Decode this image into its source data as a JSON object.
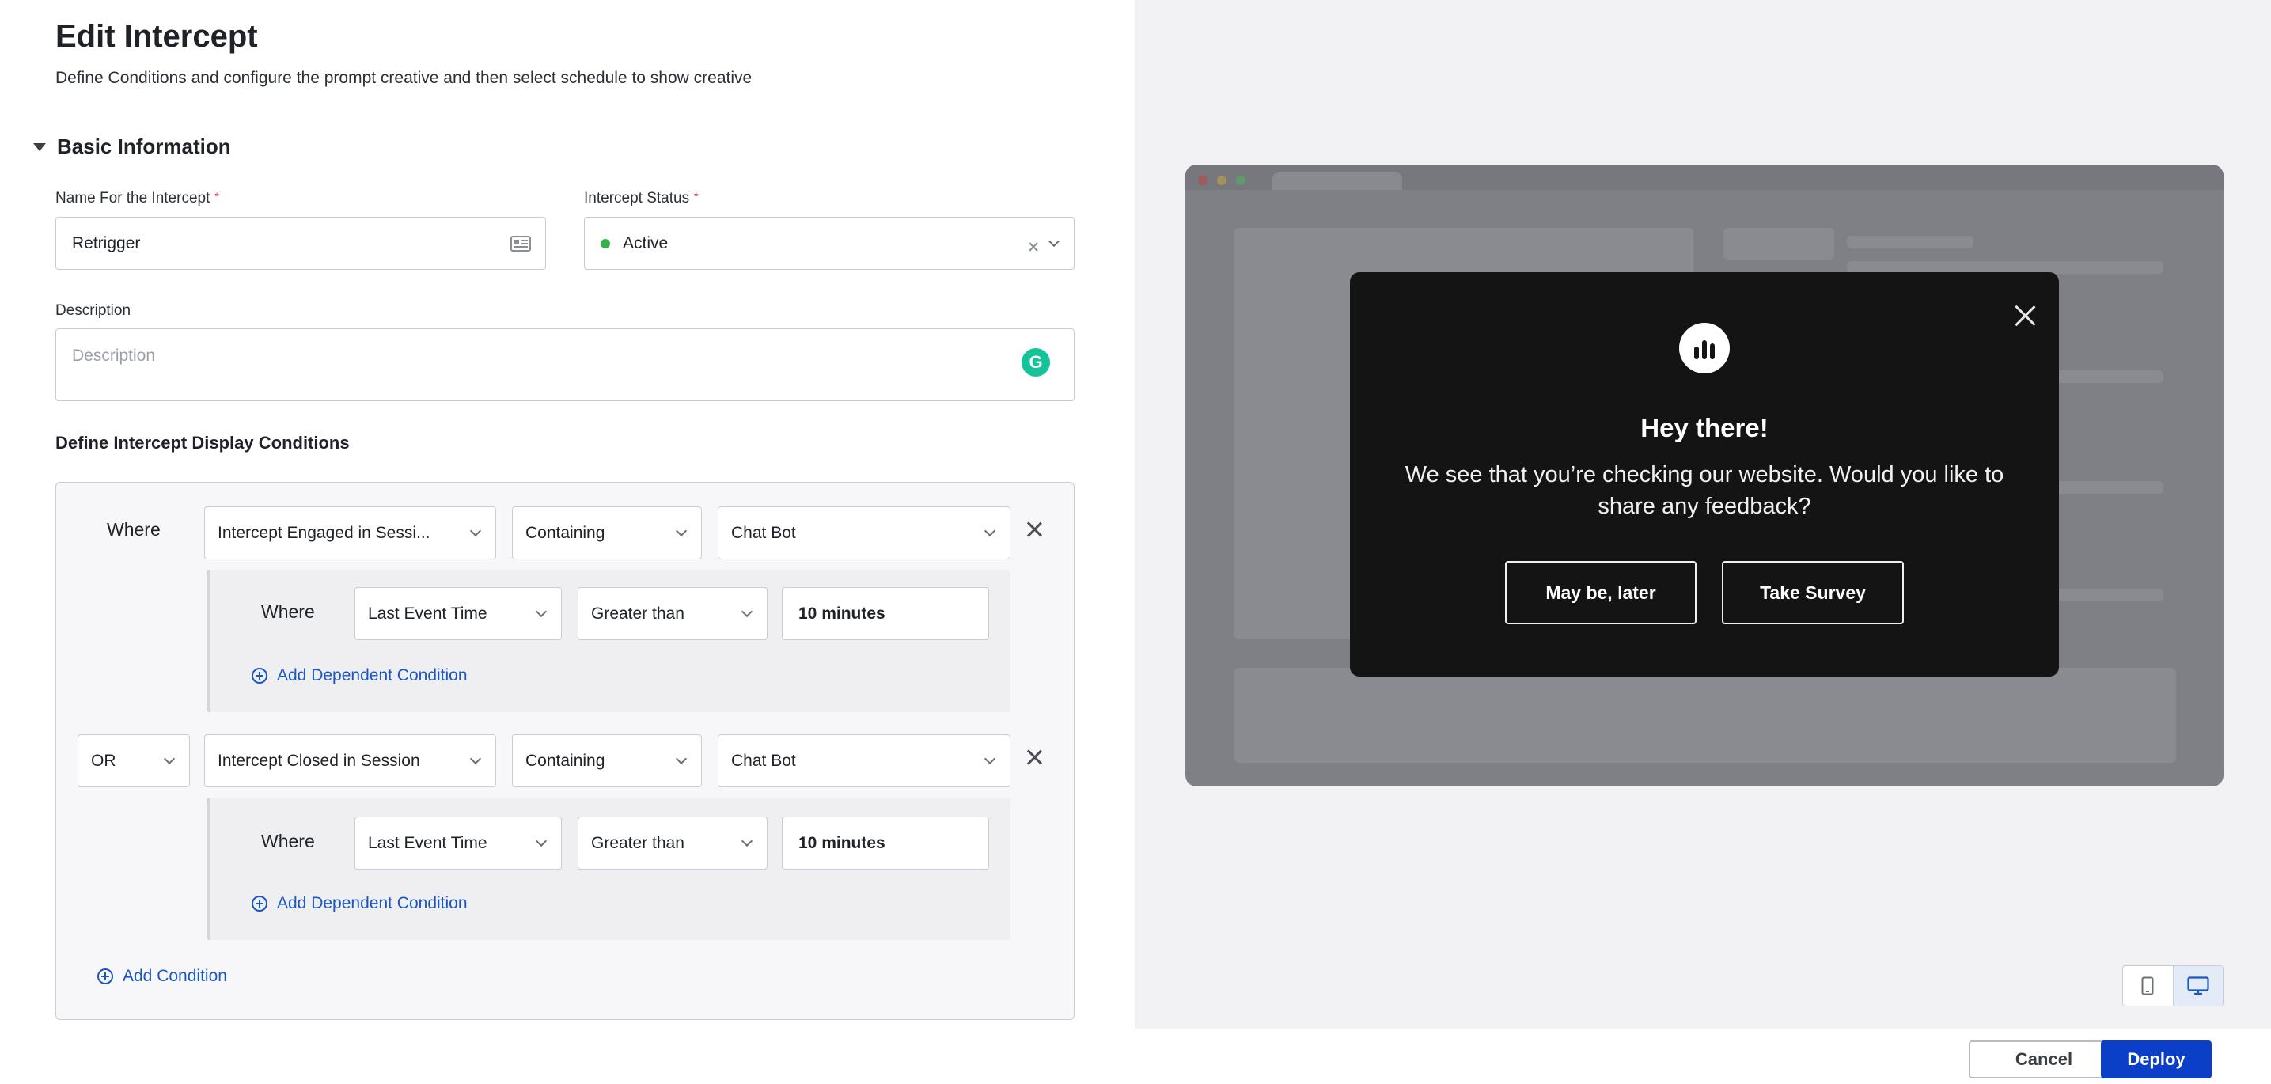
{
  "header": {
    "title": "Edit Intercept",
    "subtitle": "Define Conditions and configure the prompt creative and then select schedule to show creative"
  },
  "basic_info": {
    "section_title": "Basic Information",
    "name_label": "Name For the Intercept",
    "name_value": "Retrigger",
    "status_label": "Intercept Status",
    "status_value": "Active",
    "status_color": "#34b24a",
    "required_mark": "*",
    "description_label": "Description",
    "description_placeholder": "Description",
    "grammarly_glyph": "G"
  },
  "conditions": {
    "title": "Define Intercept Display Conditions",
    "groups": [
      {
        "connector": "Where",
        "field": "Intercept Engaged in Sessi...",
        "operator": "Containing",
        "value": "Chat Bot",
        "dependent": {
          "connector": "Where",
          "field": "Last Event Time",
          "operator": "Greater than",
          "value": "10 minutes"
        },
        "add_dependent_label": "Add Dependent Condition"
      },
      {
        "connector": "OR",
        "field": "Intercept Closed in Session",
        "operator": "Containing",
        "value": "Chat Bot",
        "dependent": {
          "connector": "Where",
          "field": "Last Event Time",
          "operator": "Greater than",
          "value": "10 minutes"
        },
        "add_dependent_label": "Add Dependent Condition"
      }
    ],
    "add_condition_label": "Add Condition"
  },
  "preview": {
    "heading": "Hey there!",
    "message": "We see that you’re checking our website. Would you like to share any feedback?",
    "secondary_button": "May be, later",
    "primary_button": "Take Survey",
    "modal_bg": "#141414",
    "frame_bg": "#7f7f86"
  },
  "footer": {
    "cancel_label": "Cancel",
    "deploy_label": "Deploy",
    "accent": "#0b3fc7"
  },
  "icons": {
    "caret": "caret-down-icon",
    "id_card": "id-card-icon",
    "clear": "clear-icon",
    "chevron": "chevron-down-icon",
    "remove": "close-icon",
    "add": "plus-circle-icon",
    "mobile": "mobile-icon",
    "desktop": "desktop-icon"
  }
}
